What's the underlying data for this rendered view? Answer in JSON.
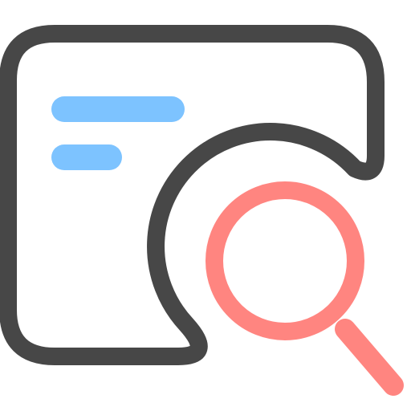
{
  "icon": {
    "name": "document-search-icon",
    "components": [
      "document-frame",
      "text-line-long",
      "text-line-short",
      "magnifier-lens",
      "magnifier-handle"
    ]
  },
  "colors": {
    "frame": "#474747",
    "lines": "#7DC3FF",
    "magnifier": "#FF8580",
    "background": "#FFFFFF"
  }
}
